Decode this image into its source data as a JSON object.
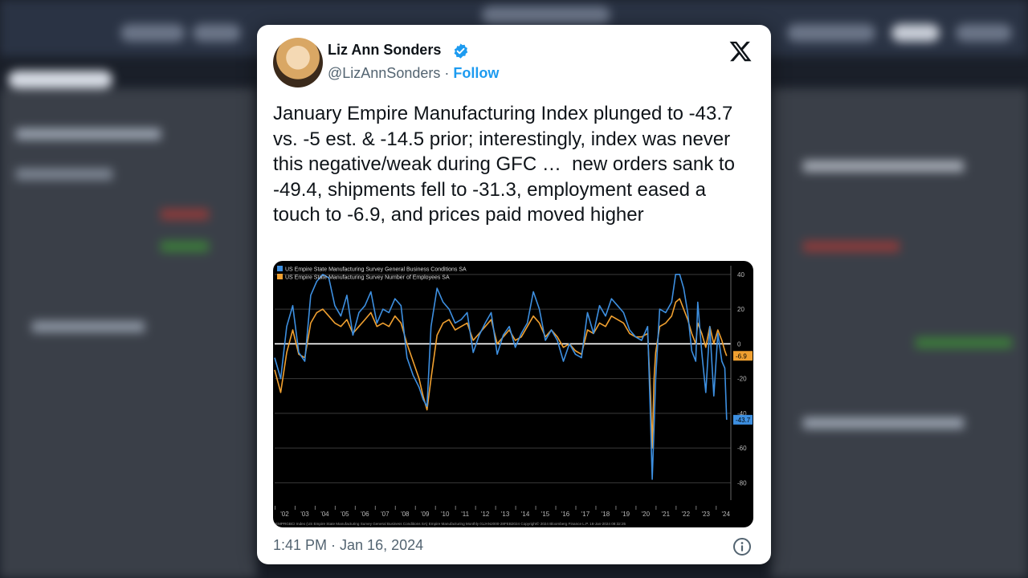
{
  "tweet": {
    "author_name": "Liz Ann Sonders",
    "handle": "@LizAnnSonders",
    "separator": "·",
    "follow_label": "Follow",
    "text": "January Empire Manufacturing Index plunged to -43.7 vs. -5 est. & -14.5 prior; interestingly, index was never this negative/weak during GFC …  new orders sank to -49.4, shipments fell to -31.3, employment eased a touch to -6.9, and prices paid moved higher",
    "timestamp": "1:41 PM · Jan 16, 2024"
  },
  "icons": {
    "verified": "verified-badge-icon",
    "x_logo": "x-logo-icon",
    "info": "info-icon"
  },
  "colors": {
    "accent": "#1d9bf0",
    "series_general": "#3d8fe0",
    "series_employees": "#f0a030",
    "chart_bg": "#000000"
  },
  "chart_data": {
    "type": "line",
    "legend": [
      "US Empire State Manufacturing Survey General Business Conditions SA",
      "US Empire State Manufacturing Survey Number of Employees SA"
    ],
    "legend_position": "top-left",
    "x_tick_labels": [
      "'02",
      "'03",
      "'04",
      "'05",
      "'06",
      "'07",
      "'08",
      "'09",
      "'10",
      "'11",
      "'12",
      "'13",
      "'14",
      "'15",
      "'16",
      "'17",
      "'18",
      "'19",
      "'20",
      "'21",
      "'22",
      "'23",
      "'24"
    ],
    "y_ticks": [
      40,
      20,
      0,
      -20,
      -40,
      -60,
      -80
    ],
    "ylim": [
      -90,
      45
    ],
    "xlim": [
      2001.5,
      2024.25
    ],
    "last_value_labels": [
      {
        "series": "Number of Employees",
        "value": "-6.9"
      },
      {
        "series": "General Business Conditions",
        "value": "-43.7"
      }
    ],
    "footer": "EMPRGBCI Index (US Empire State Manufacturing Survey General Business Conditions SA) Empire Manufacturing  Monthly 01JAN2000-28FEB2024          Copyright© 2024 Bloomberg Finance L.P.          16-Jan-2024 08:32:25",
    "series": [
      {
        "name": "US Empire State Manufacturing Survey General Business Conditions SA",
        "color": "#3d8fe0",
        "x": [
          2001.5,
          2001.8,
          2002.1,
          2002.4,
          2002.7,
          2003.0,
          2003.3,
          2003.6,
          2003.9,
          2004.2,
          2004.5,
          2004.8,
          2005.1,
          2005.4,
          2005.7,
          2006.0,
          2006.3,
          2006.6,
          2006.9,
          2007.2,
          2007.5,
          2007.8,
          2008.1,
          2008.4,
          2008.7,
          2008.9,
          2009.1,
          2009.3,
          2009.6,
          2009.9,
          2010.2,
          2010.5,
          2010.8,
          2011.1,
          2011.4,
          2011.7,
          2012.0,
          2012.3,
          2012.6,
          2012.9,
          2013.2,
          2013.5,
          2013.8,
          2014.1,
          2014.4,
          2014.7,
          2015.0,
          2015.3,
          2015.6,
          2015.9,
          2016.2,
          2016.5,
          2016.8,
          2017.1,
          2017.4,
          2017.7,
          2018.0,
          2018.3,
          2018.6,
          2018.9,
          2019.2,
          2019.5,
          2019.8,
          2020.1,
          2020.25,
          2020.33,
          2020.42,
          2020.5,
          2020.7,
          2021.0,
          2021.3,
          2021.5,
          2021.7,
          2021.9,
          2022.1,
          2022.3,
          2022.5,
          2022.6,
          2022.8,
          2023.0,
          2023.2,
          2023.4,
          2023.6,
          2023.8,
          2023.95,
          2024.04
        ],
        "y": [
          -8,
          -20,
          10,
          22,
          -5,
          -10,
          28,
          36,
          40,
          38,
          22,
          16,
          28,
          5,
          18,
          22,
          30,
          12,
          20,
          18,
          26,
          22,
          -8,
          -18,
          -25,
          -32,
          -36,
          10,
          32,
          24,
          20,
          12,
          14,
          18,
          -5,
          5,
          12,
          18,
          -6,
          5,
          10,
          -2,
          6,
          12,
          30,
          20,
          2,
          8,
          2,
          -10,
          0,
          -6,
          -8,
          18,
          6,
          22,
          16,
          26,
          22,
          18,
          8,
          4,
          2,
          10,
          -45,
          -78,
          -48,
          -20,
          20,
          18,
          24,
          40,
          40,
          32,
          18,
          -4,
          -10,
          24,
          -5,
          -28,
          10,
          -30,
          6,
          -10,
          -14,
          -43.7
        ]
      },
      {
        "name": "US Empire State Manufacturing Survey Number of Employees SA",
        "color": "#f0a030",
        "x": [
          2001.5,
          2001.8,
          2002.1,
          2002.4,
          2002.7,
          2003.0,
          2003.3,
          2003.6,
          2003.9,
          2004.2,
          2004.5,
          2004.8,
          2005.1,
          2005.4,
          2005.7,
          2006.0,
          2006.3,
          2006.6,
          2006.9,
          2007.2,
          2007.5,
          2007.8,
          2008.1,
          2008.4,
          2008.7,
          2008.9,
          2009.1,
          2009.3,
          2009.6,
          2009.9,
          2010.2,
          2010.5,
          2010.8,
          2011.1,
          2011.4,
          2011.7,
          2012.0,
          2012.3,
          2012.6,
          2012.9,
          2013.2,
          2013.5,
          2013.8,
          2014.1,
          2014.4,
          2014.7,
          2015.0,
          2015.3,
          2015.6,
          2015.9,
          2016.2,
          2016.5,
          2016.8,
          2017.1,
          2017.4,
          2017.7,
          2018.0,
          2018.3,
          2018.6,
          2018.9,
          2019.2,
          2019.5,
          2019.8,
          2020.1,
          2020.25,
          2020.33,
          2020.42,
          2020.5,
          2020.7,
          2021.0,
          2021.3,
          2021.5,
          2021.7,
          2021.9,
          2022.1,
          2022.3,
          2022.5,
          2022.6,
          2022.8,
          2023.0,
          2023.2,
          2023.4,
          2023.6,
          2023.8,
          2023.95,
          2024.04
        ],
        "y": [
          -15,
          -28,
          -5,
          8,
          -6,
          -8,
          12,
          18,
          20,
          16,
          12,
          10,
          14,
          6,
          10,
          14,
          18,
          10,
          12,
          10,
          16,
          12,
          0,
          -10,
          -20,
          -30,
          -38,
          -20,
          5,
          12,
          14,
          8,
          10,
          12,
          2,
          6,
          10,
          14,
          0,
          4,
          8,
          2,
          4,
          10,
          16,
          12,
          4,
          8,
          4,
          -2,
          0,
          -4,
          -6,
          8,
          6,
          12,
          10,
          16,
          14,
          12,
          6,
          4,
          4,
          6,
          -30,
          -60,
          -20,
          -5,
          10,
          12,
          16,
          24,
          26,
          20,
          14,
          6,
          0,
          12,
          6,
          -2,
          10,
          0,
          8,
          2,
          -4,
          -6.9
        ]
      }
    ]
  }
}
